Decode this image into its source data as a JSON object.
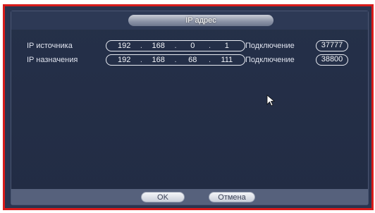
{
  "dialog": {
    "title": "IP адрес"
  },
  "rows": [
    {
      "label": "IP источника",
      "ip": [
        "192",
        "168",
        "0",
        "1"
      ],
      "conn_label": "Подключение",
      "port": "37777"
    },
    {
      "label": "IP назначения",
      "ip": [
        "192",
        "168",
        "68",
        "111"
      ],
      "conn_label": "Подключение",
      "port": "38800"
    }
  ],
  "buttons": {
    "ok": "OK",
    "cancel": "Отмена"
  },
  "colors": {
    "frame": "#d81b1b",
    "dialog_bg": "#222c44",
    "text": "#e6e9f2"
  }
}
